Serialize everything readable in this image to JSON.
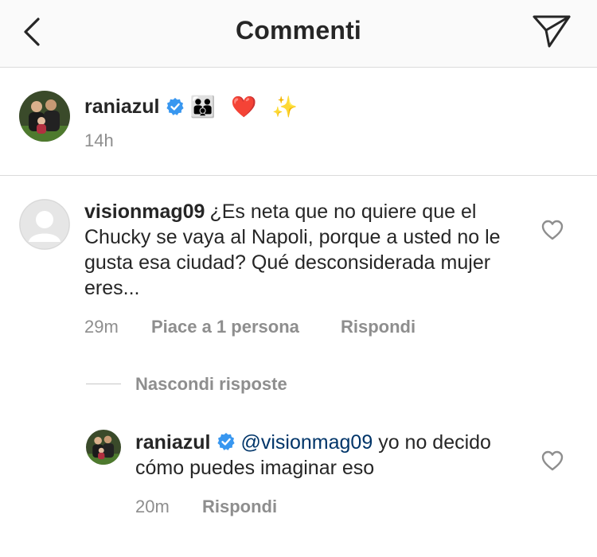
{
  "header": {
    "title": "Commenti",
    "back_icon": "chevron-left-icon",
    "send_icon": "paper-plane-icon"
  },
  "caption": {
    "username": "raniazul",
    "verified": true,
    "emojis": "👪 ❤️ ✨",
    "time": "14h"
  },
  "comment": {
    "username": "visionmag09",
    "text": "¿Es neta que no quiere que el Chucky se vaya al Napoli, porque a usted no le gusta esa ciudad? Qué desconsiderada mujer eres...",
    "time": "29m",
    "likes": "Piace a 1 persona",
    "reply_label": "Rispondi"
  },
  "hide_replies": "Nascondi risposte",
  "reply": {
    "username": "raniazul",
    "verified": true,
    "mention": "@visionmag09",
    "text": "yo no decido cómo puedes imaginar eso",
    "time": "20m",
    "reply_label": "Rispondi"
  },
  "colors": {
    "verified_blue": "#3897f0",
    "mention": "#003569",
    "secondary_text": "#8e8e8e"
  }
}
